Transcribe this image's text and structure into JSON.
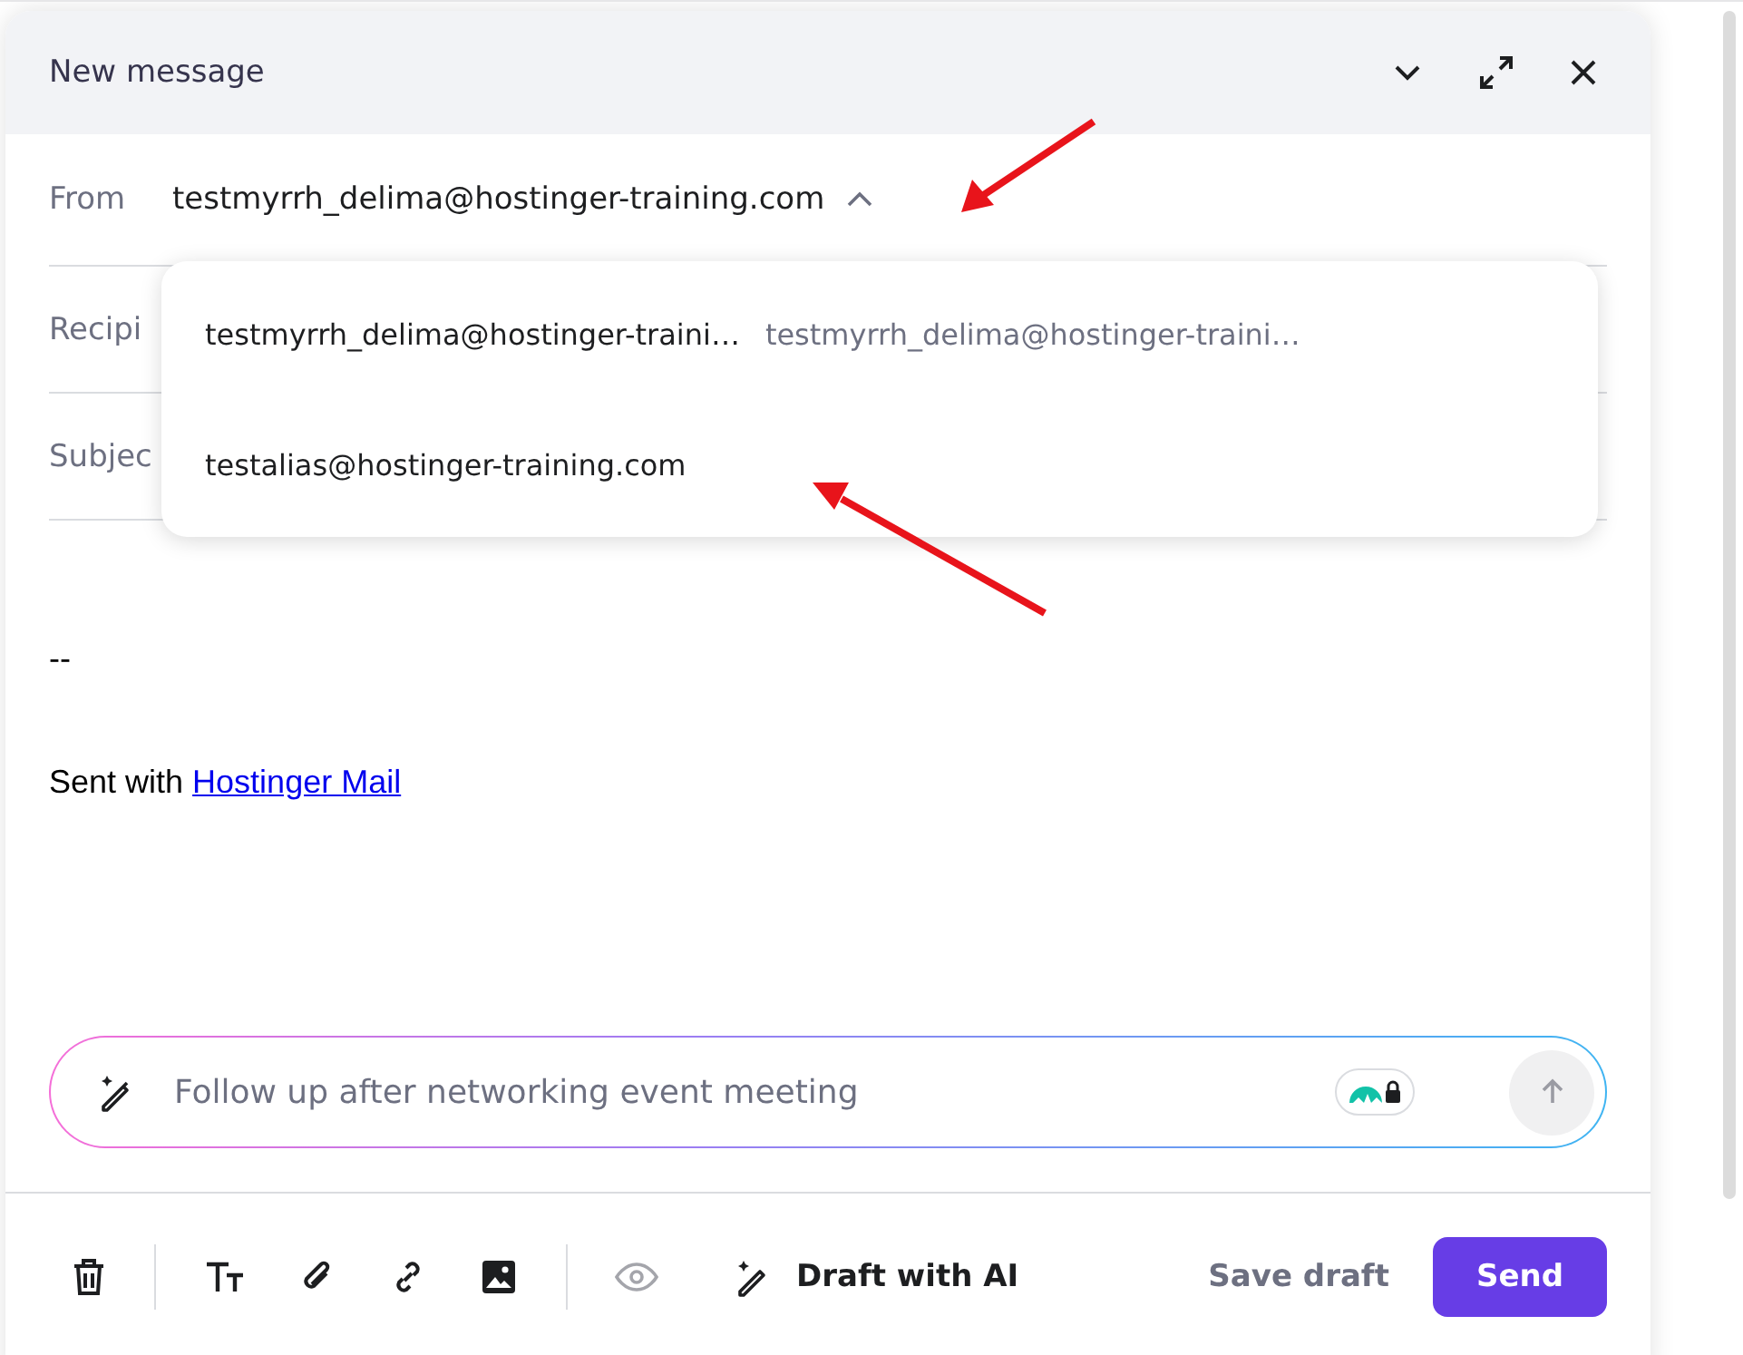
{
  "window": {
    "title": "New message"
  },
  "from": {
    "label": "From",
    "value": "testmyrrh_delima@hostinger-training.com",
    "expanded": true
  },
  "fields": [
    {
      "label": "Recipi"
    },
    {
      "label": "Subjec"
    }
  ],
  "dropdown": [
    {
      "address": "testmyrrh_delima@hostinger-traini…",
      "name": "testmyrrh_delima@hostinger-traini…"
    },
    {
      "address": "testalias@hostinger-training.com"
    }
  ],
  "body": {
    "signature_separator": "--",
    "signature_text": "Sent with ",
    "signature_link": "Hostinger Mail"
  },
  "ai_prompt": {
    "placeholder": "Follow up after networking event meeting"
  },
  "toolbar": {
    "draft_ai": "Draft with AI",
    "save_draft": "Save draft",
    "send": "Send"
  }
}
